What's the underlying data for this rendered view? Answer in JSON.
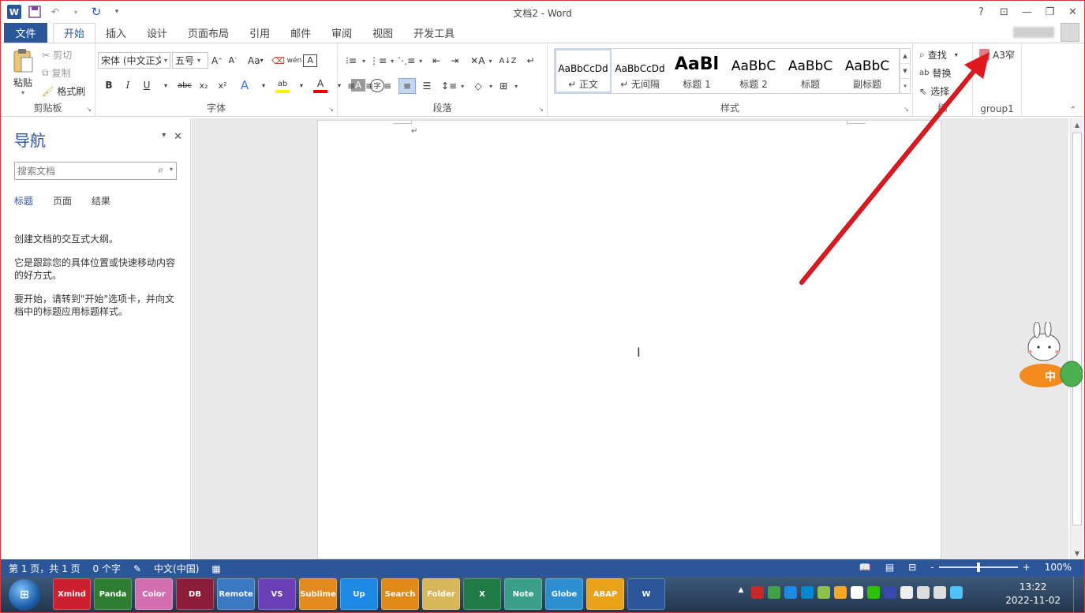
{
  "titlebar": {
    "title": "文档2 - Word",
    "app_icon": "word-icon",
    "quick_access": [
      "save-icon",
      "undo-icon",
      "redo-icon",
      "customize-icon"
    ],
    "window_controls": [
      "?",
      "ribbon-display-icon",
      "minimize-icon",
      "restore-icon",
      "close-icon"
    ]
  },
  "tabs": {
    "file": "文件",
    "items": [
      "开始",
      "插入",
      "设计",
      "页面布局",
      "引用",
      "邮件",
      "审阅",
      "视图",
      "开发工具"
    ],
    "active": "开始"
  },
  "ribbon": {
    "clipboard": {
      "label": "剪贴板",
      "paste": "粘贴",
      "cut": "剪切",
      "copy": "复制",
      "format_painter": "格式刷"
    },
    "font": {
      "label": "字体",
      "font_name": "宋体 (中文正文",
      "font_size": "五号",
      "change_case": "Aa",
      "bold": "B",
      "italic": "I",
      "underline": "U",
      "strike": "abc",
      "subscript": "x₂",
      "superscript": "x²",
      "text_effects": "A",
      "font_color": "A",
      "char_shading": "A",
      "enclose": "字",
      "phonetic": "wén"
    },
    "paragraph": {
      "label": "段落"
    },
    "styles": {
      "label": "样式",
      "items": [
        {
          "preview": "AaBbCcDd",
          "name": "↵ 正文"
        },
        {
          "preview": "AaBbCcDd",
          "name": "↵ 无间隔"
        },
        {
          "preview": "AaBl",
          "name": "标题 1"
        },
        {
          "preview": "AaBbC",
          "name": "标题 2"
        },
        {
          "preview": "AaBbC",
          "name": "标题"
        },
        {
          "preview": "AaBbC",
          "name": "副标题"
        }
      ]
    },
    "editing": {
      "label": "编",
      "find": "查找",
      "replace": "替换",
      "select": "选择"
    },
    "group1": {
      "label": "group1",
      "button": "A3窄"
    }
  },
  "nav_pane": {
    "title": "导航",
    "search_placeholder": "搜索文档",
    "tabs": [
      "标题",
      "页面",
      "结果"
    ],
    "active_tab": "标题",
    "hint1": "创建文档的交互式大纲。",
    "hint2": "它是跟踪您的具体位置或快速移动内容的好方式。",
    "hint3": "要开始，请转到\"开始\"选项卡，并向文档中的标题应用标题样式。"
  },
  "document": {
    "paragraph_mark": "↵"
  },
  "status": {
    "page": "第 1 页，共 1 页",
    "words": "0 个字",
    "language": "中文(中国)",
    "zoom": "100%",
    "zoom_minus": "-",
    "zoom_plus": "+"
  },
  "taskbar": {
    "apps": [
      "Xmind",
      "Panda",
      "Color",
      "DB",
      "Remote",
      "VS",
      "Sublime",
      "Up",
      "Search",
      "Folder",
      "X",
      "Note",
      "Globe",
      "ABAP",
      "W"
    ],
    "time": "13:22",
    "date": "2022-11-02"
  },
  "colors": {
    "accent": "#2b579a",
    "annotation_arrow": "#e0181f"
  }
}
